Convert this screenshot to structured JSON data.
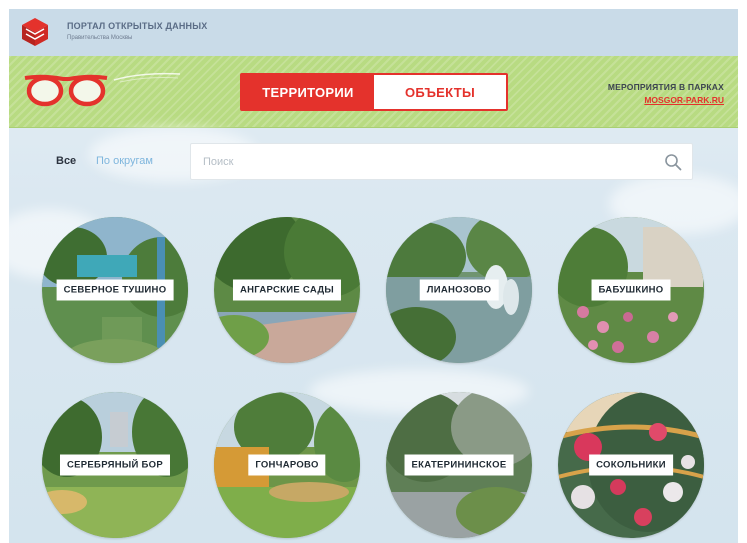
{
  "header": {
    "portal_title": "ПОРТАЛ ОТКРЫТЫХ ДАННЫХ",
    "portal_subtitle": "Правительства Москвы"
  },
  "toggle": {
    "territories_label": "ТЕРРИТОРИИ",
    "objects_label": "ОБЪЕКТЫ",
    "active": "ТЕРРИТОРИИ"
  },
  "events": {
    "label": "МЕРОПРИЯТИЯ В ПАРКАХ",
    "link": "MOSGOR-PARK.RU"
  },
  "filters": {
    "all_label": "Все",
    "by_district_label": "По округам"
  },
  "search": {
    "placeholder": "Поиск",
    "value": ""
  },
  "parks": [
    {
      "label": "СЕВЕРНОЕ ТУШИНО"
    },
    {
      "label": "АНГАРСКИЕ САДЫ"
    },
    {
      "label": "ЛИАНОЗОВО"
    },
    {
      "label": "БАБУШКИНО"
    },
    {
      "label": "СЕРЕБРЯНЫЙ БОР"
    },
    {
      "label": "ГОНЧАРОВО"
    },
    {
      "label": "ЕКАТЕРИНИНСКОЕ"
    },
    {
      "label": "СОКОЛЬНИКИ"
    }
  ],
  "colors": {
    "accent_red": "#e4322c",
    "green_band": "#b8db82",
    "link_blue": "#7fb6dd"
  }
}
